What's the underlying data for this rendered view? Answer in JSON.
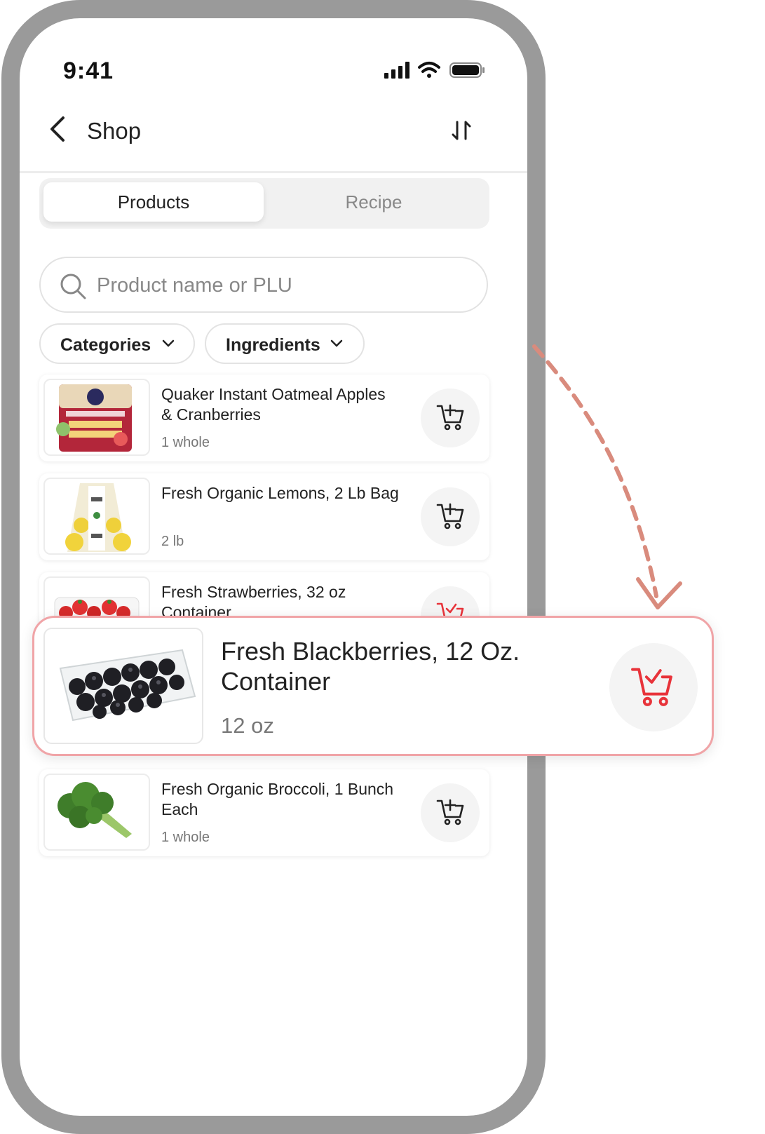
{
  "status": {
    "time": "9:41"
  },
  "header": {
    "title": "Shop",
    "back_icon": "chevron-left-icon",
    "sort_icon": "sort-icon"
  },
  "tabs": [
    {
      "label": "Products",
      "active": true
    },
    {
      "label": "Recipe",
      "active": false
    }
  ],
  "search": {
    "placeholder": "Product name or PLU",
    "value": ""
  },
  "filters": [
    {
      "label": "Categories"
    },
    {
      "label": "Ingredients"
    }
  ],
  "products": [
    {
      "name": "Quaker Instant Oatmeal Apples & Cranberries",
      "qty": "1 whole",
      "in_cart": false
    },
    {
      "name": "Fresh Organic Lemons, 2 Lb Bag",
      "qty": "2 lb",
      "in_cart": false
    },
    {
      "name": "Fresh Strawberries, 32 oz Container",
      "qty": "",
      "in_cart": true
    },
    {
      "name": "Fresh Blackberries, 12 Oz. Container",
      "qty": "12 oz",
      "in_cart": true
    },
    {
      "name": "Fresh Organic Broccoli, 1 Bunch Each",
      "qty": "1 whole",
      "in_cart": false
    }
  ],
  "colors": {
    "accent": "#e8333a",
    "highlight_border": "#f0a4a7",
    "arrow": "#d98b7d",
    "frame": "#9a9a9a"
  }
}
